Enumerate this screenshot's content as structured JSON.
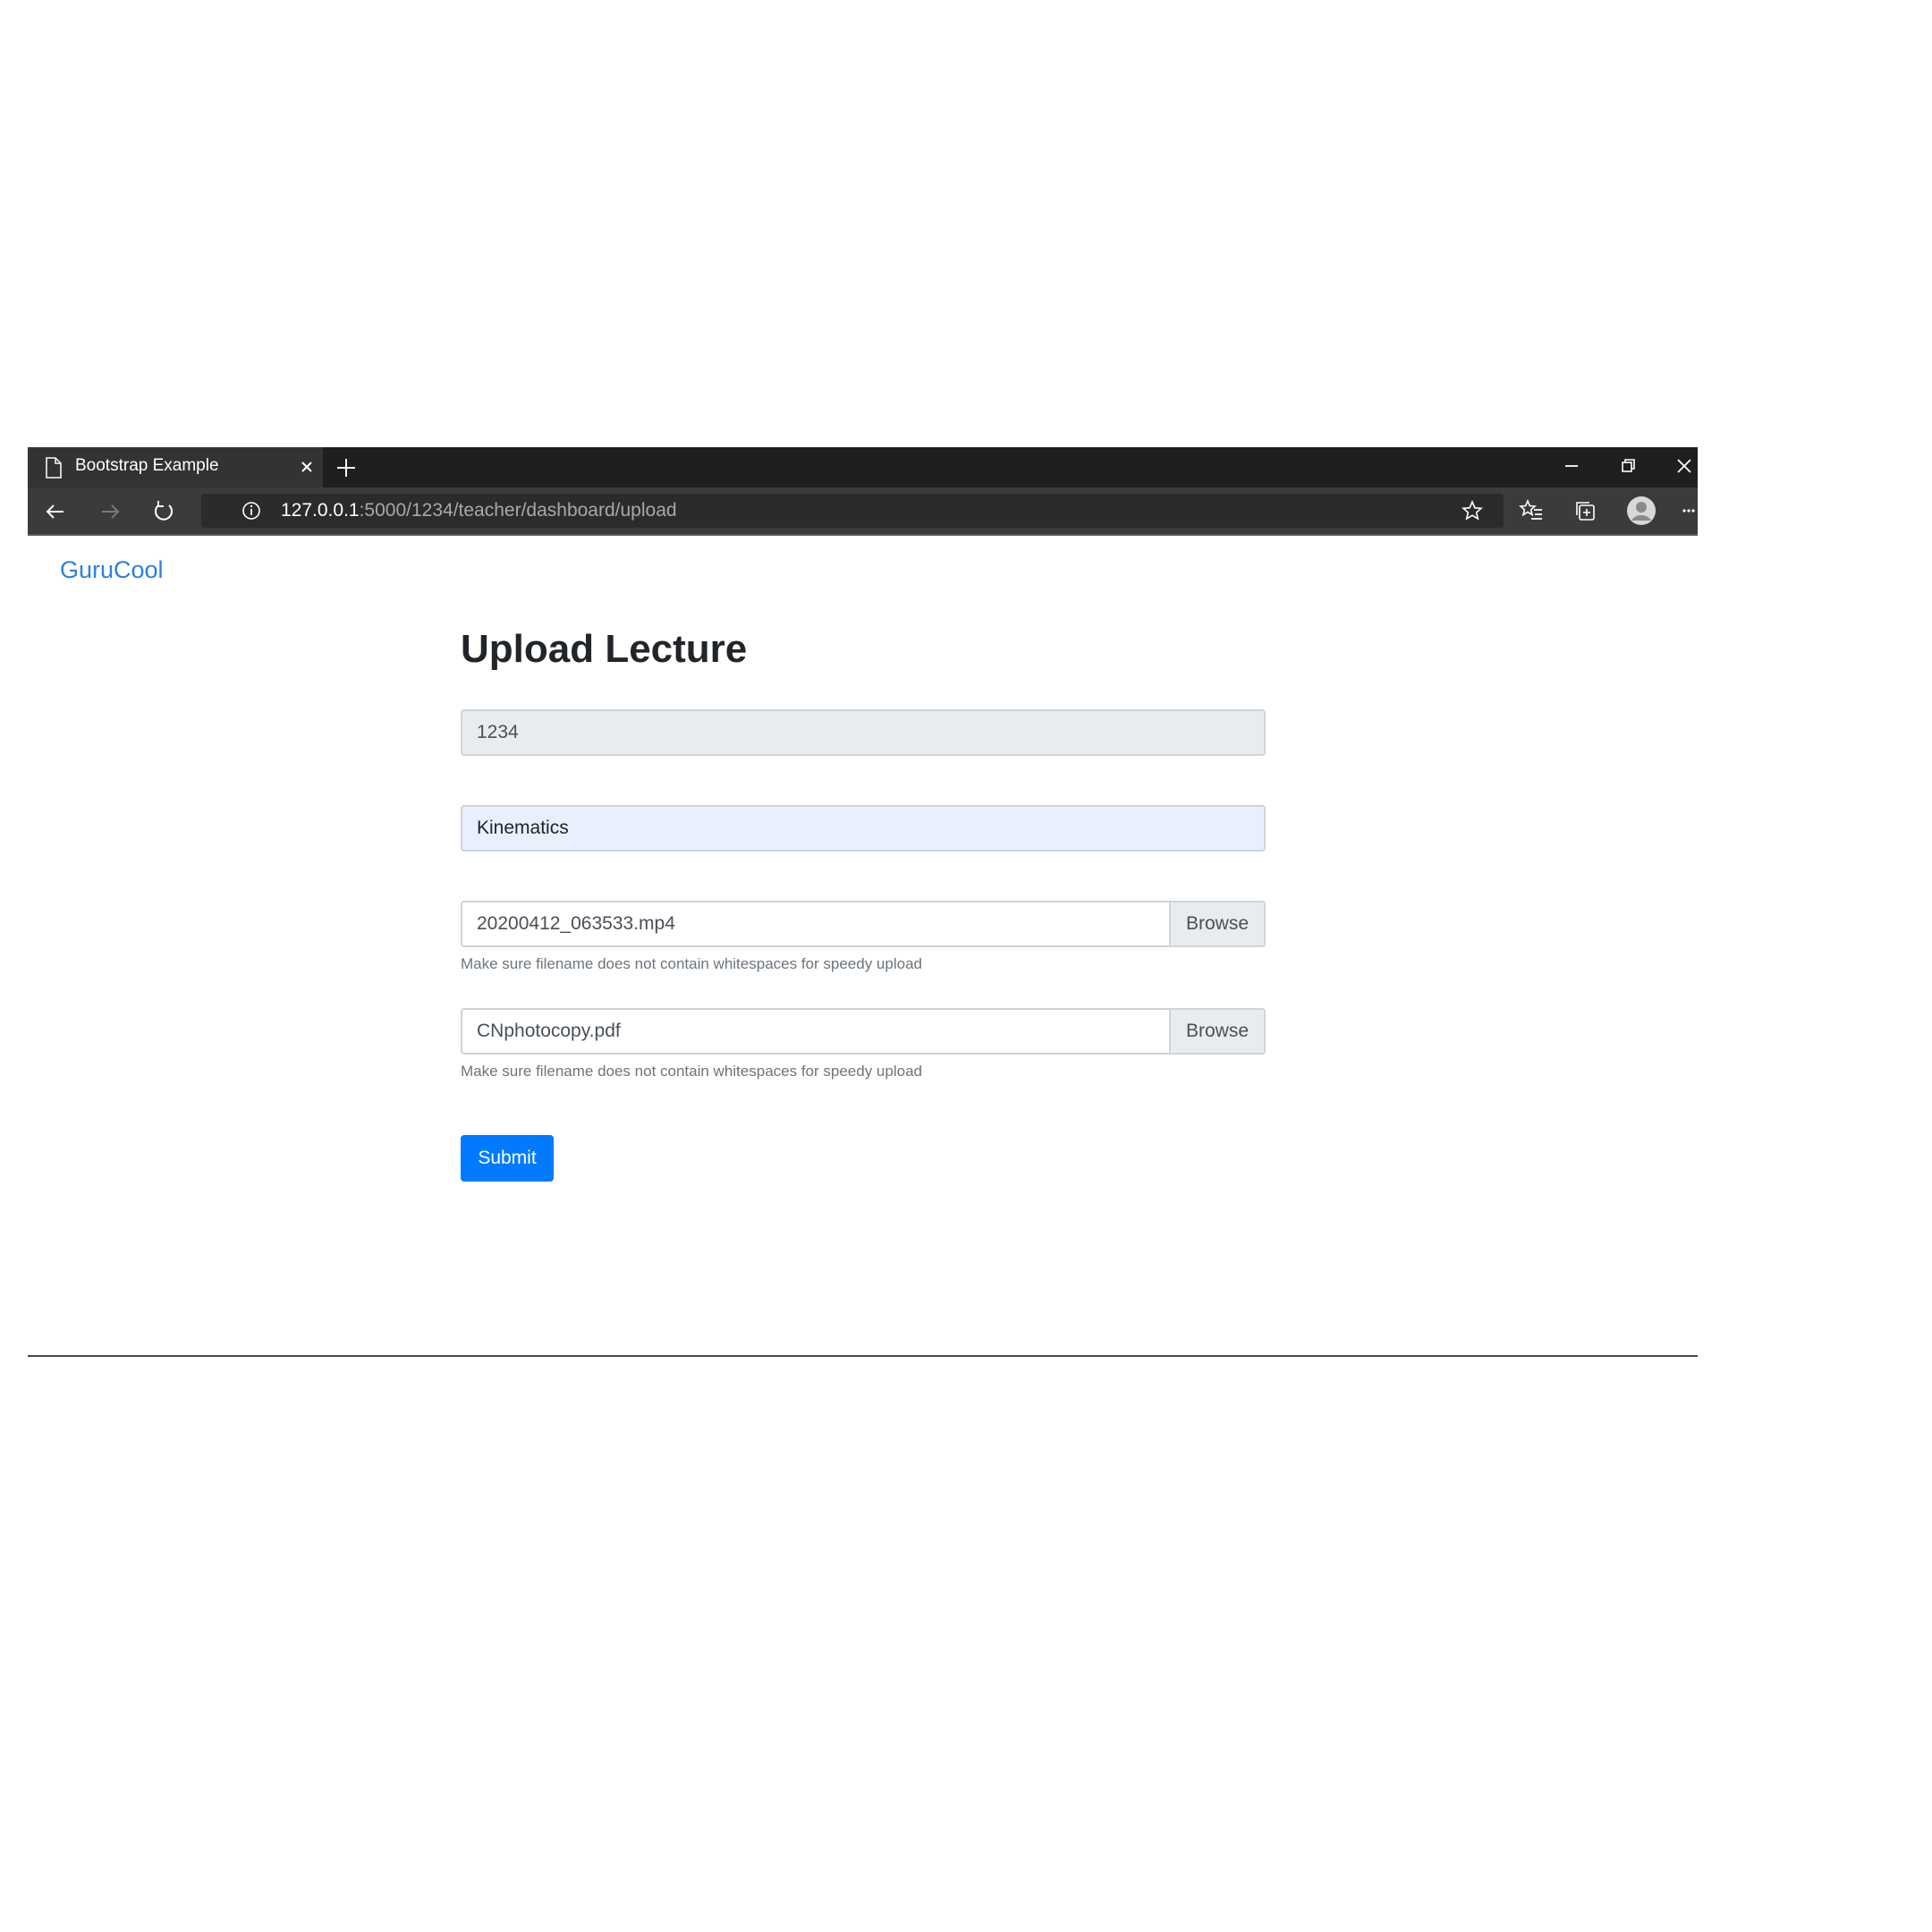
{
  "browser": {
    "tab": {
      "title": "Bootstrap Example",
      "icon": "page-icon"
    },
    "url": {
      "host": "127.0.0.1",
      "path": ":5000/1234/teacher/dashboard/upload"
    },
    "colors": {
      "tabbar": "#1f1f1f",
      "toolbar": "#3b3b3b",
      "active_tab": "#333333"
    }
  },
  "navbar": {
    "brand": "GuruCool",
    "brand_color": "#2f7fe0"
  },
  "form": {
    "title": "Upload Lecture",
    "course_id": {
      "value": "1234"
    },
    "lecture_name": {
      "value": "Kinematics"
    },
    "video_file": {
      "filename": "20200412_063533.mp4",
      "browse_label": "Browse",
      "help": "Make sure filename does not contain whitespaces for speedy upload"
    },
    "notes_file": {
      "filename": "CNphotocopy.pdf",
      "browse_label": "Browse",
      "help": "Make sure filename does not contain whitespaces for speedy upload"
    },
    "submit_label": "Submit",
    "submit_color": "#007bff"
  }
}
